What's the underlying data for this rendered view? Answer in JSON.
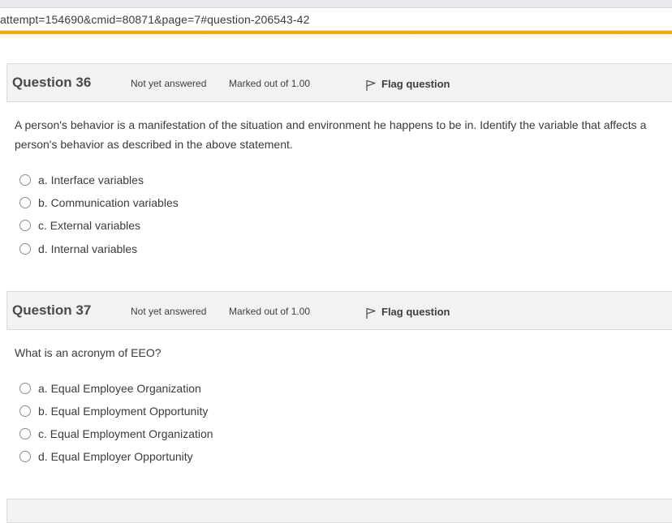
{
  "browser": {
    "url": "attempt=154690&cmid=80871&page=7#question-206543-42"
  },
  "questions": [
    {
      "title": "Question 36",
      "state": "Not yet answered",
      "marks": "Marked out of 1.00",
      "flag_label": "Flag question",
      "text": "A person's behavior is a manifestation of the situation and environment he happens to be in.  Identify the variable that affects a person's behavior as described in the above statement.",
      "options": [
        "a. Interface variables",
        "b. Communication variables",
        "c. External variables",
        "d. Internal variables"
      ]
    },
    {
      "title": "Question 37",
      "state": "Not yet answered",
      "marks": "Marked out of 1.00",
      "flag_label": "Flag question",
      "text": "What is an acronym of EEO?",
      "options": [
        "a. Equal Employee Organization",
        "b. Equal Employment Opportunity",
        "c. Equal Employment Organization",
        "d. Equal Employer Opportunity"
      ]
    }
  ],
  "colors": {
    "accent": "#f0a80b",
    "header_bg": "#f2f2f2"
  }
}
